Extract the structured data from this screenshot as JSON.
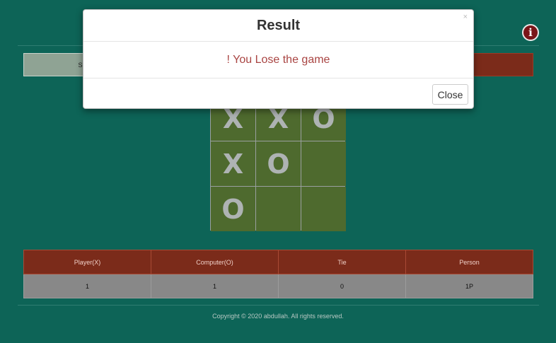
{
  "modes": {
    "single_label": "Single",
    "double_label": "e"
  },
  "board": {
    "cells": [
      "X",
      "X",
      "O",
      "X",
      "O",
      "",
      "O",
      "",
      ""
    ]
  },
  "score": {
    "headers": [
      "Player(X)",
      "Computer(O)",
      "Tie",
      "Person"
    ],
    "values": [
      "1",
      "1",
      "0",
      "1P"
    ]
  },
  "footer": {
    "copyright": "Copyright © 2020 abdullah. All rights reserved."
  },
  "modal": {
    "title": "Result",
    "close_x": "×",
    "message": "! You Lose the game",
    "close_label": "Close"
  },
  "colors": {
    "background": "#0d6457",
    "board_cell": "#4e6a2e",
    "header_red": "#7b2b1a",
    "message_red": "#a94442"
  },
  "icons": {
    "info": "info-icon"
  }
}
